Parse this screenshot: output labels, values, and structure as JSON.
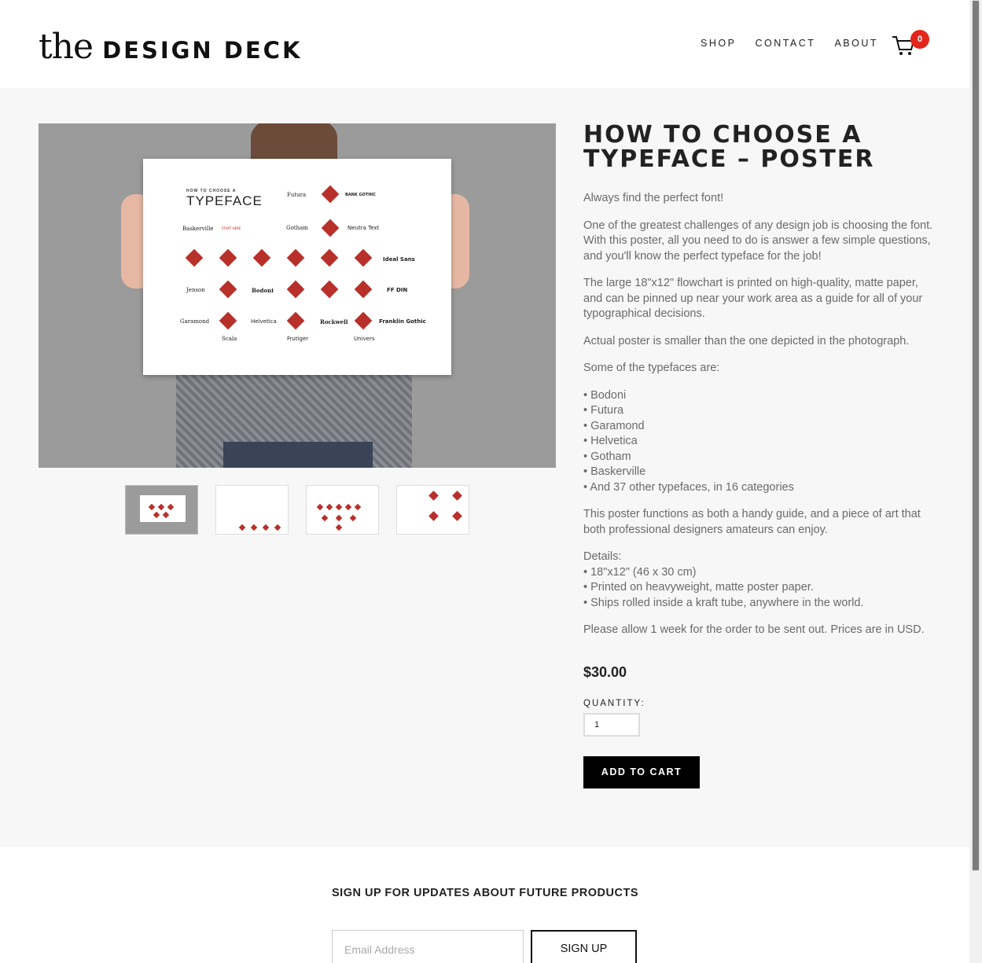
{
  "header": {
    "logo_the": "the",
    "logo_brand": "DESIGN DECK",
    "nav": [
      "SHOP",
      "CONTACT",
      "ABOUT"
    ],
    "cart_count": "0"
  },
  "product": {
    "title": "HOW TO CHOOSE A TYPEFACE – POSTER",
    "tagline": "Always find the perfect font!",
    "para1": "One of the greatest challenges of any design job is choosing the font. With this poster, all you need to do is answer a few simple questions, and you'll know the perfect typeface for the job!",
    "para2": "The large 18\"x12\" flowchart is printed on high-quality, matte paper, and can be pinned up near your work area as a guide for all of your typographical decisions.",
    "para3": "Actual poster is smaller than the one depicted in the photograph.",
    "para4": "Some of the typefaces are:",
    "typefaces": [
      "• Bodoni",
      "• Futura",
      "• Garamond",
      "• Helvetica",
      "• Gotham",
      "• Baskerville",
      "• And 37 other typefaces, in 16 categories"
    ],
    "para5": "This poster functions as both a handy guide, and a piece of art that both professional designers amateurs can enjoy.",
    "details_label": "Details:",
    "details": [
      "• 18\"x12\" (46 x 30 cm)",
      "• Printed on heavyweight, matte poster paper.",
      "• Ships rolled inside a kraft tube, anywhere in the world."
    ],
    "para6": "Please allow 1 week for the order to be sent out. Prices are in USD.",
    "price": "$30.00",
    "quantity_label": "QUANTITY:",
    "quantity_value": "1",
    "add_to_cart": "ADD TO CART"
  },
  "poster": {
    "small_title": "HOW TO CHOOSE A",
    "big_title": "TYPEFACE",
    "labels": [
      "Futura",
      "BANK GOTHIC",
      "Baskerville",
      "START HERE",
      "Gotham",
      "Neutra Text",
      "Ideal Sans",
      "Jenson",
      "Bodoni",
      "FF DIN",
      "Garamond",
      "Helvetica",
      "Rockwell",
      "Franklin Gothic",
      "Scala",
      "Frutiger",
      "Univers"
    ]
  },
  "signup": {
    "heading": "SIGN UP FOR UPDATES ABOUT FUTURE PRODUCTS",
    "email_placeholder": "Email Address",
    "button": "SIGN UP"
  },
  "colors": {
    "accent_red": "#e3261c",
    "diamond_red": "#b8302a",
    "button_black": "#000000"
  }
}
